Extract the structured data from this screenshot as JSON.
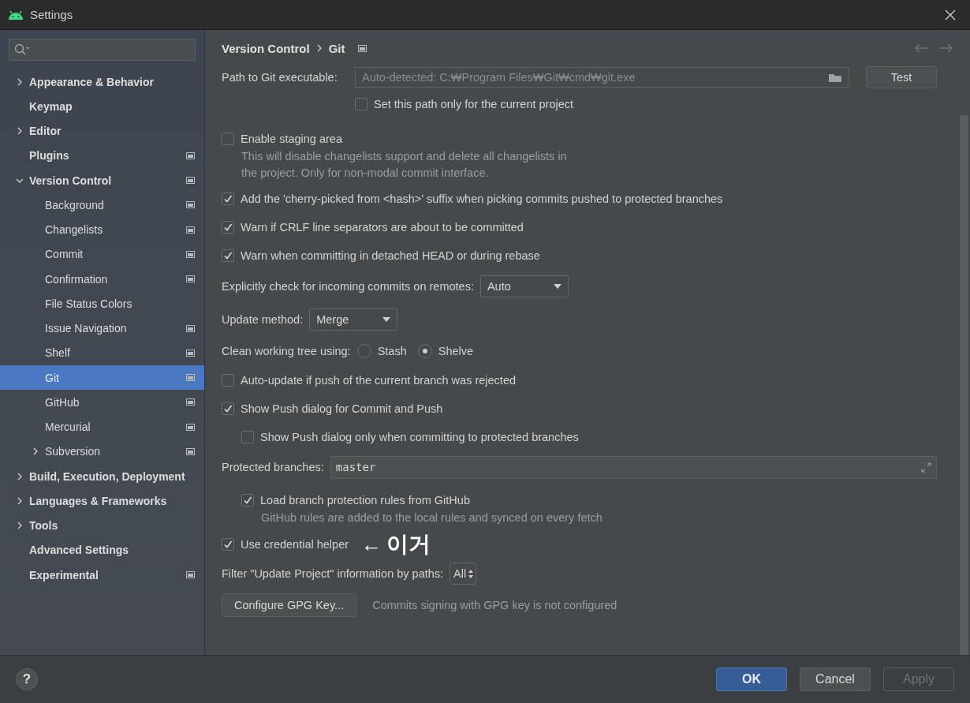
{
  "window": {
    "title": "Settings"
  },
  "sidebar": {
    "items": [
      {
        "label": "Appearance & Behavior",
        "kind": "folder",
        "expanded": false,
        "project_scope": false,
        "selected": false
      },
      {
        "label": "Keymap",
        "kind": "page",
        "project_scope": false,
        "selected": false
      },
      {
        "label": "Editor",
        "kind": "folder",
        "expanded": false,
        "project_scope": false,
        "selected": false
      },
      {
        "label": "Plugins",
        "kind": "page",
        "project_scope": true,
        "selected": false
      },
      {
        "label": "Version Control",
        "kind": "folder",
        "expanded": true,
        "project_scope": true,
        "selected": false,
        "children": [
          {
            "label": "Background",
            "kind": "page",
            "project_scope": true,
            "selected": false
          },
          {
            "label": "Changelists",
            "kind": "page",
            "project_scope": true,
            "selected": false
          },
          {
            "label": "Commit",
            "kind": "page",
            "project_scope": true,
            "selected": false
          },
          {
            "label": "Confirmation",
            "kind": "page",
            "project_scope": true,
            "selected": false
          },
          {
            "label": "File Status Colors",
            "kind": "page",
            "project_scope": false,
            "selected": false
          },
          {
            "label": "Issue Navigation",
            "kind": "page",
            "project_scope": true,
            "selected": false
          },
          {
            "label": "Shelf",
            "kind": "page",
            "project_scope": true,
            "selected": false
          },
          {
            "label": "Git",
            "kind": "page",
            "project_scope": true,
            "selected": true
          },
          {
            "label": "GitHub",
            "kind": "page",
            "project_scope": true,
            "selected": false
          },
          {
            "label": "Mercurial",
            "kind": "page",
            "project_scope": true,
            "selected": false
          },
          {
            "label": "Subversion",
            "kind": "folder",
            "expanded": false,
            "project_scope": true,
            "selected": false
          }
        ]
      },
      {
        "label": "Build, Execution, Deployment",
        "kind": "folder",
        "expanded": false,
        "project_scope": false,
        "selected": false
      },
      {
        "label": "Languages & Frameworks",
        "kind": "folder",
        "expanded": false,
        "project_scope": false,
        "selected": false
      },
      {
        "label": "Tools",
        "kind": "folder",
        "expanded": false,
        "project_scope": false,
        "selected": false
      },
      {
        "label": "Advanced Settings",
        "kind": "page",
        "project_scope": false,
        "selected": false
      },
      {
        "label": "Experimental",
        "kind": "page",
        "project_scope": true,
        "selected": false
      }
    ]
  },
  "breadcrumb": {
    "items": [
      "Version Control",
      "Git"
    ],
    "project_scope": true
  },
  "executable": {
    "label": "Path to Git executable:",
    "placeholder": "Auto-detected: C:₩Program Files₩Git₩cmd₩git.exe",
    "button": "Test",
    "option": {
      "label": "Set this path only for the current project",
      "checked": false
    }
  },
  "settings": [
    {
      "kind": "checkbox",
      "label": "Enable staging area",
      "checked": false,
      "description": "This will disable changelists support and delete all changelists in\nthe project. Only for non-modal commit interface."
    },
    {
      "kind": "checkbox",
      "label": "Add the 'cherry-picked from <hash>' suffix when picking commits pushed to protected branches",
      "checked": true
    },
    {
      "kind": "checkbox",
      "label": "Warn if CRLF line separators are about to be committed",
      "checked": true
    },
    {
      "kind": "checkbox",
      "label": "Warn when committing in detached HEAD or during rebase",
      "checked": true
    },
    {
      "kind": "dropdown",
      "label": "Explicitly check for incoming commits on remotes:",
      "value": "Auto"
    },
    {
      "kind": "dropdown",
      "label": "Update method:",
      "value": "Merge"
    },
    {
      "kind": "radio",
      "label": "Clean working tree using:",
      "options": [
        {
          "label": "Stash",
          "selected": false
        },
        {
          "label": "Shelve",
          "selected": true
        }
      ]
    },
    {
      "kind": "checkbox",
      "label": "Auto-update if push of the current branch was rejected",
      "checked": false
    },
    {
      "kind": "checkbox",
      "label": "Show Push dialog for Commit and Push",
      "checked": true,
      "children": [
        {
          "kind": "checkbox",
          "label": "Show Push dialog only when committing to protected branches",
          "checked": false
        }
      ]
    },
    {
      "kind": "textfield",
      "label": "Protected branches:",
      "value": "master",
      "children": [
        {
          "kind": "checkbox",
          "label": "Load branch protection rules from GitHub",
          "checked": true,
          "description": "GitHub rules are added to the local rules and synced on every fetch"
        }
      ]
    },
    {
      "kind": "checkbox",
      "label": "Use credential helper",
      "checked": true,
      "annotation": {
        "arrow": "←",
        "text": "이거"
      }
    },
    {
      "kind": "spinner",
      "label": "Filter \"Update Project\" information by paths:",
      "value": "All"
    },
    {
      "kind": "button",
      "label": "Configure GPG Key...",
      "note": "Commits signing with GPG key is not configured"
    }
  ],
  "footer": {
    "help": "?",
    "buttons": [
      {
        "label": "OK",
        "kind": "default",
        "disabled": false
      },
      {
        "label": "Cancel",
        "kind": "normal",
        "disabled": false
      },
      {
        "label": "Apply",
        "kind": "normal",
        "disabled": true
      }
    ]
  }
}
